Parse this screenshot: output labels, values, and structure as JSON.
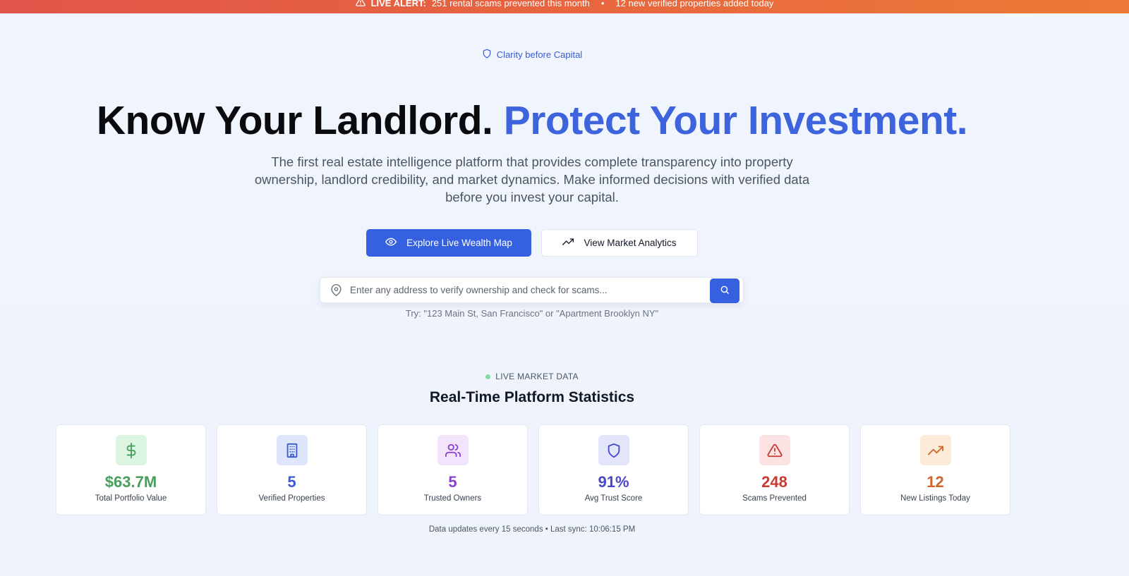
{
  "alert": {
    "label": "LIVE ALERT:",
    "message1": "251 rental scams prevented this month",
    "separator": "•",
    "message2": "12 new verified properties added today",
    "icon": "warning-triangle-icon"
  },
  "tagline": {
    "text": "Clarity before Capital",
    "icon": "shield-icon"
  },
  "hero": {
    "title_main": "Know Your Landlord.",
    "title_accent": "Protect Your Investment.",
    "subtitle": "The first real estate intelligence platform that provides complete transparency into property ownership, landlord credibility, and market dynamics. Make informed decisions with verified data before you invest your capital."
  },
  "actions": {
    "primary_label": "Explore Live Wealth Map",
    "primary_icon": "eye-icon",
    "secondary_label": "View Market Analytics",
    "secondary_icon": "trending-up-icon"
  },
  "search": {
    "placeholder": "Enter any address to verify ownership and check for scams...",
    "value": "",
    "hint": "Try: \"123 Main St, San Francisco\" or \"Apartment Brooklyn NY\""
  },
  "stats": {
    "live_label": "LIVE MARKET DATA",
    "title": "Real-Time Platform Statistics",
    "cards": [
      {
        "value": "$63.7M",
        "label": "Total Portfolio Value",
        "icon": "dollar-icon",
        "color": "#4a9e5c",
        "bg": "#dcf5e3"
      },
      {
        "value": "5",
        "label": "Verified Properties",
        "icon": "building-icon",
        "color": "#3b5bd6",
        "bg": "#dde6fb"
      },
      {
        "value": "5",
        "label": "Trusted Owners",
        "icon": "users-icon",
        "color": "#8b3fd1",
        "bg": "#f1e4fb"
      },
      {
        "value": "91%",
        "label": "Avg Trust Score",
        "icon": "shield-icon",
        "color": "#4a48c9",
        "bg": "#e3e6fb"
      },
      {
        "value": "248",
        "label": "Scams Prevented",
        "icon": "alert-triangle-icon",
        "color": "#c93a32",
        "bg": "#fbe3e3"
      },
      {
        "value": "12",
        "label": "New Listings Today",
        "icon": "trending-up-icon",
        "color": "#d0652b",
        "bg": "#fdebd9"
      }
    ],
    "footnote": "Data updates every 15 seconds • Last sync: 10:06:15 PM"
  }
}
